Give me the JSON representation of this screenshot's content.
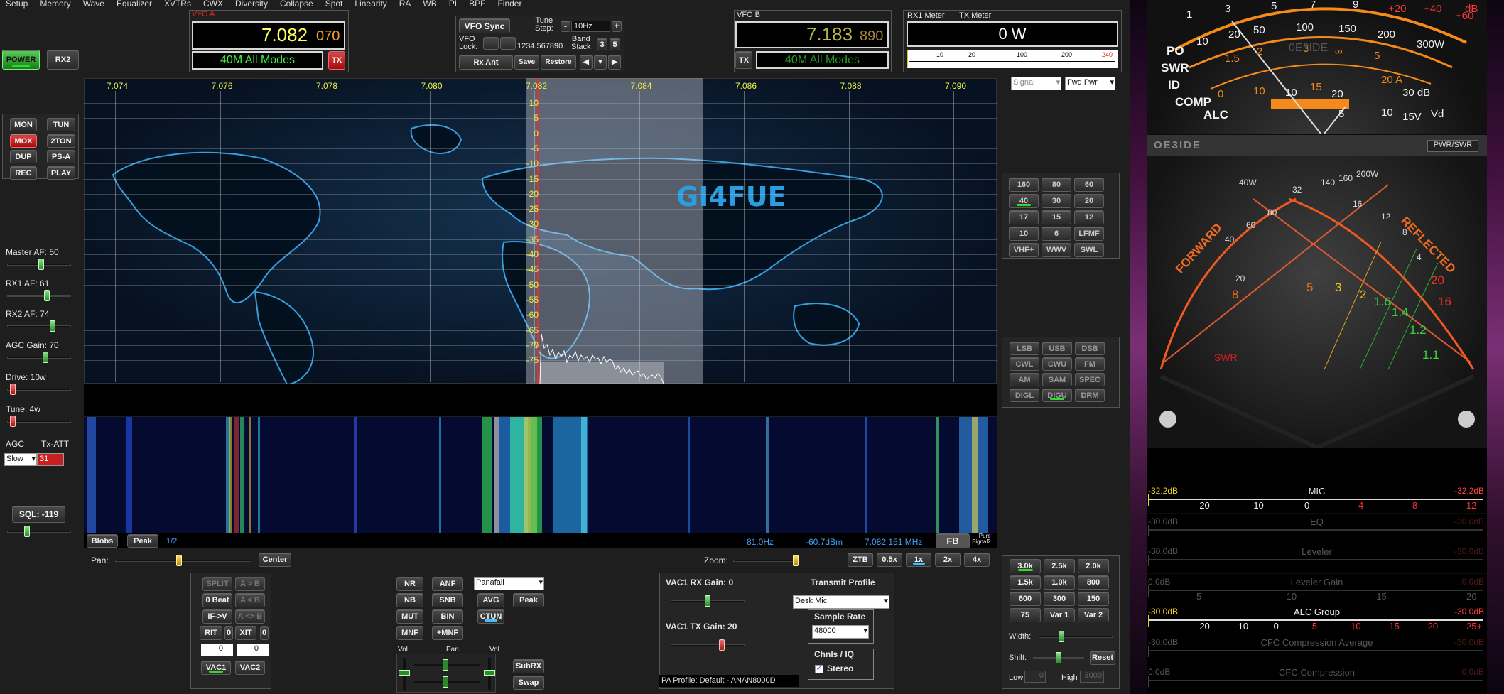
{
  "menu": [
    "Setup",
    "Memory",
    "Wave",
    "Equalizer",
    "XVTRs",
    "CWX",
    "Diversity",
    "Collapse",
    "Spot",
    "Linearity",
    "RA",
    "WB",
    "PI",
    "BPF",
    "Finder"
  ],
  "left": {
    "power": "POWER",
    "rx2": "RX2",
    "buttons": [
      "MON",
      "TUN",
      "MOX",
      "2TON",
      "DUP",
      "PS-A",
      "REC",
      "PLAY"
    ],
    "sliders": [
      {
        "label": "Master AF:  50"
      },
      {
        "label": "RX1 AF:  61"
      },
      {
        "label": "RX2 AF:  74"
      },
      {
        "label": "AGC Gain:  70"
      },
      {
        "label": "Drive:  10w"
      },
      {
        "label": "Tune:  4w"
      }
    ],
    "agc_label": "AGC",
    "txatt_label": "Tx-ATT",
    "agc_value": "Slow",
    "txatt_value": "31",
    "sql": "SQL:  -119"
  },
  "vfoA": {
    "title": "VFO A",
    "freq_main": "7.082",
    "freq_sub": "070",
    "mode": "40M All Modes",
    "tx": "TX"
  },
  "vfoB": {
    "title": "VFO B",
    "freq_main": "7.183",
    "freq_sub": "890",
    "mode": "40M All Modes",
    "tx": "TX"
  },
  "mid": {
    "vfo_sync": "VFO Sync",
    "tune_step": "Tune\nStep:",
    "minus": "-",
    "step_value": "10Hz",
    "plus": "+",
    "vfo_lock": "VFO\nLock:",
    "lock_val": "1234.567890",
    "band_stack": "Band\nStack",
    "bs3": "3",
    "bs5": "5",
    "rx_ant": "Rx Ant",
    "save": "Save",
    "restore": "Restore"
  },
  "meter": {
    "rx1": "RX1 Meter",
    "tx": "TX Meter",
    "value": "0 W",
    "scale": [
      "10",
      "20",
      "100",
      "200",
      "240"
    ],
    "sel1": "Signal",
    "sel2": "Fwd Pwr"
  },
  "spectrum": {
    "xlabels": [
      "7.074",
      "7.076",
      "7.078",
      "7.080",
      "7.082",
      "7.084",
      "7.086",
      "7.088",
      "7.090"
    ],
    "ylabels": [
      "10",
      "5",
      "0",
      "-5",
      "-10",
      "-15",
      "-20",
      "-25",
      "-30",
      "-35",
      "-40",
      "-45",
      "-50",
      "-55",
      "-60",
      "-65",
      "-70",
      "-75"
    ],
    "callsign": "GI4FUE"
  },
  "statusbar": {
    "blobs": "Blobs",
    "peak": "Peak",
    "page": "1/2",
    "hz": "81.0Hz",
    "dbm": "-60.7dBm",
    "freq": "7.082 151 MHz",
    "fb": "FB",
    "pure": "Pure\nSignal2"
  },
  "panzoom": {
    "pan": "Pan:",
    "center": "Center",
    "zoom": "Zoom:",
    "ztb": "ZTB",
    "x05": "0.5x",
    "x1": "1x",
    "x2": "2x",
    "x4": "4x"
  },
  "bands": [
    "160",
    "80",
    "60",
    "40",
    "30",
    "20",
    "17",
    "15",
    "12",
    "10",
    "6",
    "LFMF",
    "VHF+",
    "WWV",
    "SWL"
  ],
  "modes": [
    "LSB",
    "USB",
    "DSB",
    "CWL",
    "CWU",
    "FM",
    "AM",
    "SAM",
    "SPEC",
    "DIGL",
    "DIGU",
    "DRM"
  ],
  "filters": [
    "3.0k",
    "2.5k",
    "2.0k",
    "1.5k",
    "1.0k",
    "800",
    "600",
    "300",
    "150",
    "75",
    "Var 1",
    "Var 2"
  ],
  "filterctl": {
    "width": "Width:",
    "shift": "Shift:",
    "reset": "Reset",
    "low": "Low",
    "low_val": "0",
    "high": "High",
    "high_val": "3000"
  },
  "bottomleft": {
    "split": "SPLIT",
    "atob": "A > B",
    "beat": "0 Beat",
    "atob2": "A < B",
    "ifv": "IF->V",
    "aswap": "A <> B",
    "rit": "RIT",
    "rit0": "0",
    "xit": "XIT",
    "xit0": "0",
    "v1": "0",
    "v2": "0",
    "vac1": "VAC1",
    "vac2": "VAC2"
  },
  "dsp": {
    "nr": "NR",
    "anf": "ANF",
    "nb": "NB",
    "snb": "SNB",
    "mut": "MUT",
    "bin": "BIN",
    "mnf": "MNF",
    "pmnf": "+MNF",
    "avg": "AVG",
    "peak": "Peak",
    "ctun": "CTUN",
    "display": "Panafall",
    "vol": "Vol",
    "pan": "Pan",
    "vol2": "Vol",
    "subrx": "SubRX",
    "swap": "Swap"
  },
  "vac": {
    "rx_gain": "VAC1 RX Gain:  0",
    "tx_gain": "VAC1 TX Gain:  20",
    "tx_profile": "Transmit Profile",
    "profile": "Desk Mic",
    "sample_rate": "Sample Rate",
    "rate": "48000",
    "chnls": "Chnls / IQ",
    "stereo": "Stereo",
    "pa": "PA Profile: Default - ANAN8000D"
  },
  "analog": {
    "brand": "OE3IDE",
    "pwrswr": "PWR/SWR",
    "forward": "FORWARD",
    "reflected": "REFLECTED",
    "swr": "SWR",
    "top_labels": [
      "PO",
      "SWR",
      "ID",
      "COMP",
      "ALC"
    ],
    "top_nums": [
      "1",
      "3",
      "5",
      "7",
      "9",
      "+20",
      "+40",
      "+60",
      "dB",
      "10",
      "20",
      "50",
      "100",
      "150",
      "200",
      "300W",
      "1.5",
      "2",
      "3",
      "∞",
      "5",
      "10",
      "15",
      "20 A",
      "0",
      "10",
      "20",
      "30 dB",
      "5",
      "10",
      "15V",
      "Vd",
      "0E3IDE"
    ],
    "cross": [
      "40W",
      "32",
      "140",
      "160",
      "200W",
      "40",
      "60",
      "80",
      "20",
      "16",
      "12",
      "8",
      "4",
      "20",
      "16",
      "8",
      "5",
      "3",
      "2",
      "1.6",
      "1.4",
      "1.2",
      "1.1"
    ]
  },
  "bars": [
    {
      "left": "-32.2dB",
      "title": "MIC",
      "right": "-32.2dB",
      "ticks": [
        "-20",
        "-10",
        "0",
        "4",
        "8",
        "12"
      ]
    },
    {
      "left": "-30.0dB",
      "title": "EQ",
      "right": "-30.0dB",
      "ticks": []
    },
    {
      "left": "-30.0dB",
      "title": "Leveler",
      "right": "-30.0dB",
      "ticks": []
    },
    {
      "left": "0.0dB",
      "title": "Leveler Gain",
      "right": "0.0dB",
      "ticks": [
        "5",
        "10",
        "15",
        "20"
      ]
    },
    {
      "left": "-30.0dB",
      "title": "ALC Group",
      "right": "-30.0dB",
      "ticks": [
        "-20",
        "-10",
        "0",
        "5",
        "10",
        "15",
        "20",
        "25+"
      ]
    },
    {
      "left": "-30.0dB",
      "title": "CFC Compression Average",
      "right": "-30.0dB",
      "ticks": []
    },
    {
      "left": "0.0dB",
      "title": "CFC Compression",
      "right": "0.0dB",
      "ticks": []
    }
  ]
}
